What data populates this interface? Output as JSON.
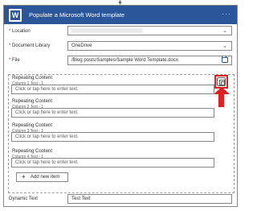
{
  "header": {
    "icon": "word-icon",
    "title": "Populate a Microsoft Word template",
    "more": "···",
    "color": "#2b579a"
  },
  "fields": {
    "location": {
      "label": "Location",
      "value": ""
    },
    "document_library": {
      "label": "Document Library",
      "value": "OneDrive"
    },
    "file": {
      "label": "File",
      "value": "/Blog posts/Samples/Sample Word Template.docx"
    }
  },
  "repeating": {
    "items": [
      {
        "label": "Repeating Content",
        "sub": "Column 1 Text - 1",
        "placeholder": "Click or tap here to enter text."
      },
      {
        "label": "Repeating Content",
        "sub": "Column 2 Text - 1",
        "placeholder": "Click or tap here to enter text."
      },
      {
        "label": "Repeating Content",
        "sub": "Column 3 Text - 1",
        "placeholder": "Click or tap here to enter text."
      },
      {
        "label": "Repeating Content",
        "sub": "Column 4 Text - 1",
        "placeholder": "Click or tap here to enter text."
      }
    ],
    "add_label": "Add new item",
    "add_icon": "+"
  },
  "dynamic": {
    "label": "Dynamic Text",
    "value": "Test Text"
  },
  "annotation_color": "#e02020"
}
